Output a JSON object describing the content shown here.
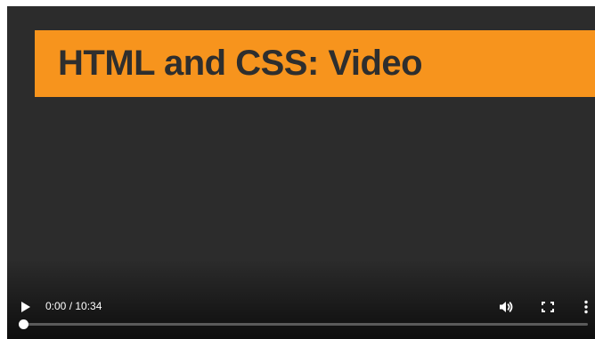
{
  "video": {
    "title_text": "HTML and CSS: Video",
    "colors": {
      "banner": "#f7941d",
      "title_text": "#2e2e2e",
      "background": "#2c2c2c"
    }
  },
  "controls": {
    "play_icon": "play-icon",
    "time_display": "0:00 / 10:34",
    "volume_icon": "volume-icon",
    "fullscreen_icon": "fullscreen-icon",
    "more_icon": "more-options-icon",
    "progress_fraction": 0.0
  }
}
